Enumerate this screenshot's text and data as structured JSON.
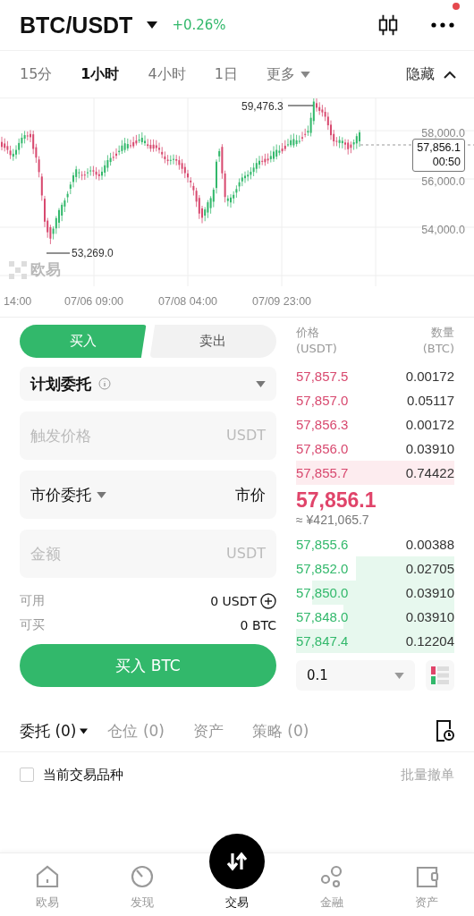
{
  "header": {
    "pair": "BTC/USDT",
    "change": "+0.26%",
    "notification": true
  },
  "timeframes": [
    {
      "label": "15分",
      "selected": false
    },
    {
      "label": "1小时",
      "selected": true
    },
    {
      "label": "4小时",
      "selected": false
    },
    {
      "label": "1日",
      "selected": false
    },
    {
      "label": "更多",
      "selected": false
    }
  ],
  "hide_label": "隐藏",
  "chart": {
    "high_label": "59,476.3",
    "low_label": "53,269.0",
    "y_labels": [
      "58,000.0",
      "56,000.0",
      "54,000.0"
    ],
    "current_price": "57,856.1",
    "countdown": "00:50",
    "x_labels": [
      "14:00",
      "07/06 09:00",
      "07/08 04:00",
      "07/09 23:00"
    ],
    "watermark": "欧易"
  },
  "trade": {
    "sides": [
      {
        "label": "买入",
        "selected": true
      },
      {
        "label": "卖出",
        "selected": false
      }
    ],
    "order_type": "计划委托",
    "trigger": {
      "placeholder": "触发价格",
      "unit": "USDT"
    },
    "market": {
      "label": "市价委托",
      "value": "市价"
    },
    "amount": {
      "placeholder": "金额",
      "unit": "USDT"
    },
    "available": {
      "label": "可用",
      "value": "0 USDT"
    },
    "can_buy": {
      "label": "可买",
      "value": "0 BTC"
    },
    "submit": "买入 BTC"
  },
  "orderbook": {
    "price_header": "价格",
    "price_unit": "(USDT)",
    "qty_header": "数量",
    "qty_unit": "(BTC)",
    "asks": [
      {
        "price": "57,857.5",
        "qty": "0.00172"
      },
      {
        "price": "57,857.0",
        "qty": "0.05117"
      },
      {
        "price": "57,856.3",
        "qty": "0.00172"
      },
      {
        "price": "57,856.0",
        "qty": "0.03910"
      },
      {
        "price": "57,855.7",
        "qty": "0.74422"
      }
    ],
    "last_price": "57,856.1",
    "fiat": "≈ ¥421,065.7",
    "bids": [
      {
        "price": "57,855.6",
        "qty": "0.00388"
      },
      {
        "price": "57,852.0",
        "qty": "0.02705"
      },
      {
        "price": "57,850.0",
        "qty": "0.03910"
      },
      {
        "price": "57,848.0",
        "qty": "0.03910"
      },
      {
        "price": "57,847.4",
        "qty": "0.12204"
      }
    ],
    "precision": "0.1"
  },
  "order_tabs": [
    {
      "label": "委托 (0)",
      "selected": true
    },
    {
      "label": "仓位 (0)",
      "selected": false
    },
    {
      "label": "资产",
      "selected": false
    },
    {
      "label": "策略 (0)",
      "selected": false
    }
  ],
  "filter": {
    "label": "当前交易品种",
    "checked": false
  },
  "batch_cancel": "批量撤单",
  "nav": [
    {
      "label": "欧易",
      "selected": false
    },
    {
      "label": "发现",
      "selected": false
    },
    {
      "label": "交易",
      "selected": true
    },
    {
      "label": "金融",
      "selected": false
    },
    {
      "label": "资产",
      "selected": false
    }
  ]
}
